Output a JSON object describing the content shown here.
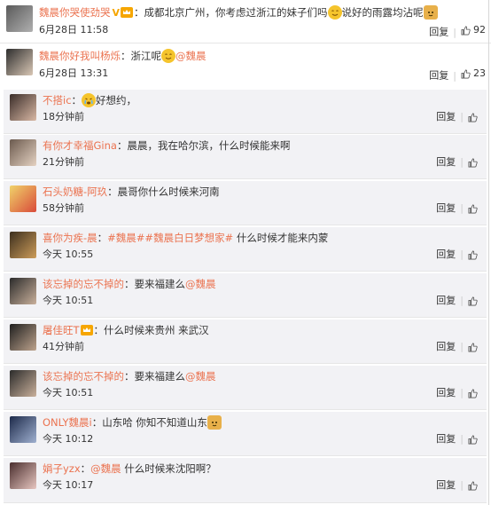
{
  "comments": [
    {
      "user": "魏晨你哭使劲哭",
      "text": "：成都北京广州，你考虑过浙江的妹子们吗",
      "text2": "说好的雨露均沾呢",
      "time": "6月28日 11:58",
      "reply": "回复",
      "likes": "92"
    },
    {
      "user": "魏晨你好我叫杨烁",
      "text": "：浙江呢",
      "mention": "@魏晨",
      "time": "6月28日 13:31",
      "reply": "回复",
      "likes": "23"
    }
  ],
  "replies": [
    {
      "user": "不搭ic",
      "text": "：",
      "text2": "好想约，",
      "time": "18分钟前",
      "reply": "回复"
    },
    {
      "user": "有你才幸福Gina",
      "text": "：晨晨，我在哈尔滨，什么时候能来啊",
      "time": "21分钟前",
      "reply": "回复"
    },
    {
      "user": "石头奶糖-阿玖",
      "text": "：晨哥你什么时候来河南",
      "time": "58分钟前",
      "reply": "回复"
    },
    {
      "user": "喜你为疾-晨",
      "text": "：",
      "tag": "#魏晨##魏晨白日梦想家#",
      "text2": " 什么时候才能来内蒙",
      "time": "今天 10:55",
      "reply": "回复"
    },
    {
      "user": "该忘掉的忘不掉的",
      "text": "：要来福建么",
      "mention": "@魏晨",
      "time": "今天 10:51",
      "reply": "回复"
    },
    {
      "user": "屠佳旺T",
      "text": "：什么时候来贵州 来武汉",
      "time": "41分钟前",
      "reply": "回复"
    },
    {
      "user": "该忘掉的忘不掉的",
      "text": "：要来福建么",
      "mention": "@魏晨",
      "time": "今天 10:51",
      "reply": "回复"
    },
    {
      "user": "ONLY魏晨i",
      "text": "：山东哈  你知不知道山东",
      "time": "今天 10:12",
      "reply": "回复"
    },
    {
      "user": "娟子yzx",
      "text": "：",
      "mention": "@魏晨",
      "text2": " 什么时候来沈阳啊？",
      "time": "今天 10:17",
      "reply": "回复"
    }
  ],
  "colors": {
    "username": "#eb7350",
    "background": "#f2f2f5",
    "text": "#333333"
  }
}
